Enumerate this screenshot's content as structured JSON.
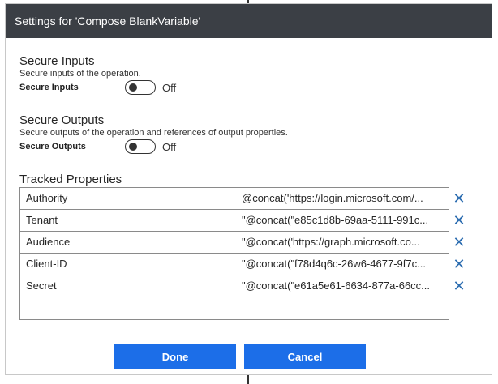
{
  "dialog": {
    "title": "Settings for 'Compose BlankVariable'"
  },
  "secure_inputs": {
    "title": "Secure Inputs",
    "description": "Secure inputs of the operation.",
    "label": "Secure Inputs",
    "state": "Off"
  },
  "secure_outputs": {
    "title": "Secure Outputs",
    "description": "Secure outputs of the operation and references of output properties.",
    "label": "Secure Outputs",
    "state": "Off"
  },
  "tracked_properties": {
    "title": "Tracked Properties",
    "rows": [
      {
        "key": "Authority",
        "value": "@concat('https://login.microsoft.com/..."
      },
      {
        "key": "Tenant",
        "value": "\"@concat(\"e85c1d8b-69aa-5111-991c..."
      },
      {
        "key": "Audience",
        "value": "\"@concat('https://graph.microsoft.co..."
      },
      {
        "key": "Client-ID",
        "value": "\"@concat(\"f78d4q6c-26w6-4677-9f7c..."
      },
      {
        "key": "Secret",
        "value": "\"@concat(\"e61a5e61-6634-877a-66cc..."
      },
      {
        "key": "",
        "value": ""
      }
    ]
  },
  "buttons": {
    "done": "Done",
    "cancel": "Cancel"
  },
  "icons": {
    "remove": "close-icon"
  },
  "colors": {
    "header_bg": "#3b3f45",
    "primary": "#1c6ee8",
    "remove_icon": "#2b6cb0"
  }
}
